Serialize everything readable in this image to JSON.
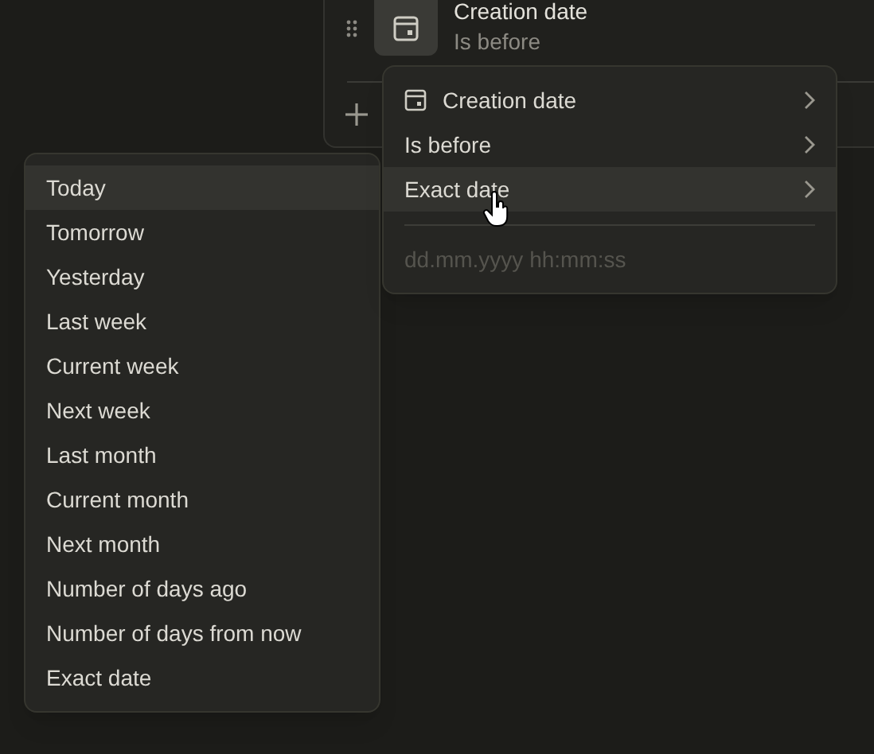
{
  "filter": {
    "field": "Creation date",
    "condition": "Is before"
  },
  "menu": {
    "items": [
      {
        "kind": "field",
        "label": "Creation date",
        "highlighted": false
      },
      {
        "kind": "plain",
        "label": "Is before",
        "highlighted": false
      },
      {
        "kind": "plain",
        "label": "Exact date",
        "highlighted": true
      }
    ],
    "date_input": {
      "placeholder": "dd.mm.yyyy hh:mm:ss"
    }
  },
  "date_options": [
    {
      "label": "Today",
      "highlighted": true
    },
    {
      "label": "Tomorrow",
      "highlighted": false
    },
    {
      "label": "Yesterday",
      "highlighted": false
    },
    {
      "label": "Last week",
      "highlighted": false
    },
    {
      "label": "Current week",
      "highlighted": false
    },
    {
      "label": "Next week",
      "highlighted": false
    },
    {
      "label": "Last month",
      "highlighted": false
    },
    {
      "label": "Current month",
      "highlighted": false
    },
    {
      "label": "Next month",
      "highlighted": false
    },
    {
      "label": "Number of days ago",
      "highlighted": false
    },
    {
      "label": "Number of days from now",
      "highlighted": false
    },
    {
      "label": "Exact date",
      "highlighted": false
    }
  ]
}
